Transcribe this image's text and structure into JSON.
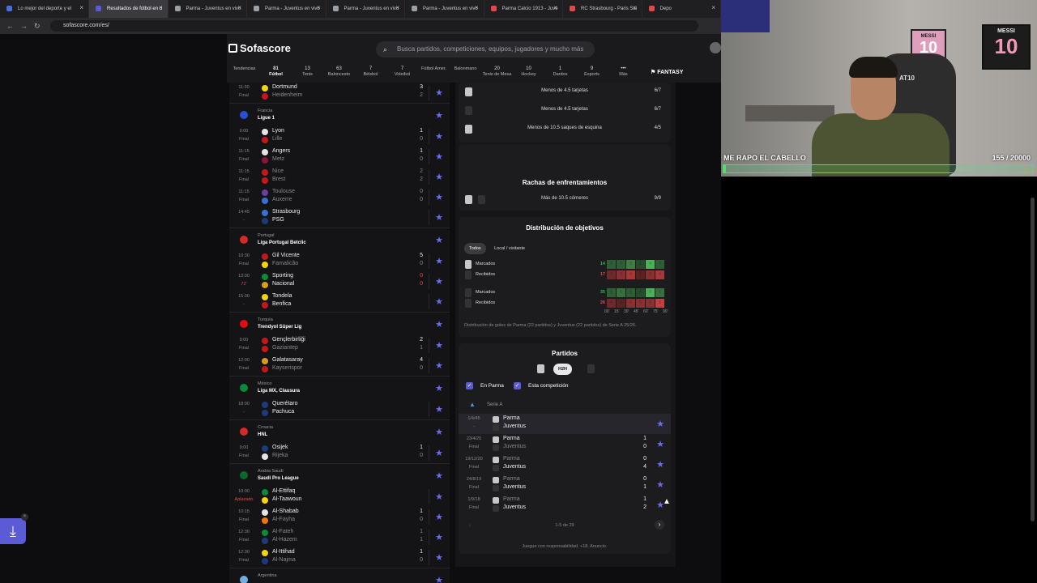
{
  "browser": {
    "tabs": [
      {
        "label": "Lo mejor del deporte y el",
        "color": "#4a6ee0"
      },
      {
        "label": "Resultados de fútbol en d",
        "color": "#5b5bd6"
      },
      {
        "label": "Parma - Juventus en vivo",
        "color": "#9aa0a6"
      },
      {
        "label": "Parma - Juventus en vivo",
        "color": "#9aa0a6"
      },
      {
        "label": "Parma - Juventus en vivo",
        "color": "#9aa0a6"
      },
      {
        "label": "Parma - Juventus en vivo",
        "color": "#9aa0a6"
      },
      {
        "label": "Parma Calcio 1913 - Juve",
        "color": "#e34848"
      },
      {
        "label": "RC Strasbourg - Paris Sai",
        "color": "#e34848"
      },
      {
        "label": "Depo",
        "color": "#e34848"
      }
    ],
    "active_tab": 1,
    "url": "sofascore.com/es/"
  },
  "header": {
    "logo": "Sofascore",
    "search_placeholder": "Busca partidos, competiciones, equipos, jugadores y mucho más",
    "fantasy": "FANTASY"
  },
  "sports": [
    {
      "label": "Tendencias",
      "count": ""
    },
    {
      "label": "Fútbol",
      "count": "81"
    },
    {
      "label": "Tenis",
      "count": "13"
    },
    {
      "label": "Baloncesto",
      "count": "63"
    },
    {
      "label": "Béisbol",
      "count": "7"
    },
    {
      "label": "Voleibol",
      "count": "7"
    },
    {
      "label": "Fútbol Amer.",
      "count": ""
    },
    {
      "label": "Balonmano",
      "count": ""
    },
    {
      "label": "Tenis de Mesa",
      "count": "20"
    },
    {
      "label": "Hockey",
      "count": "10"
    },
    {
      "label": "Dardos",
      "count": "1"
    },
    {
      "label": "Esports",
      "count": "9"
    },
    {
      "label": "Más",
      "count": "•••"
    }
  ],
  "left": [
    {
      "type": "match",
      "t1": "11:30",
      "t2": "Final",
      "home": "Dortmund",
      "away": "Heidenheim",
      "hs": "3",
      "as": "2",
      "hc": "#f5d400",
      "ac": "#c4161c",
      "hdim": false,
      "adim": true
    },
    {
      "type": "league",
      "country": "Francia",
      "name": "Ligue 1",
      "flag": "#2a4fd6"
    },
    {
      "type": "match",
      "t1": "9:00",
      "t2": "Final",
      "home": "Lyon",
      "away": "Lille",
      "hs": "1",
      "as": "0",
      "hc": "#e5e5e5",
      "ac": "#c4161c",
      "hdim": false,
      "adim": true
    },
    {
      "type": "match",
      "t1": "11:15",
      "t2": "Final",
      "home": "Angers",
      "away": "Metz",
      "hs": "1",
      "as": "0",
      "hc": "#e5e5e5",
      "ac": "#8a1538",
      "hdim": false,
      "adim": true
    },
    {
      "type": "match",
      "t1": "11:15",
      "t2": "Final",
      "home": "Nice",
      "away": "Brest",
      "hs": "2",
      "as": "2",
      "hc": "#c4161c",
      "ac": "#c4161c",
      "hdim": true,
      "adim": true
    },
    {
      "type": "match",
      "t1": "11:15",
      "t2": "Final",
      "home": "Toulouse",
      "away": "Auxerre",
      "hs": "0",
      "as": "0",
      "hc": "#6b3fa0",
      "ac": "#3a6fd0",
      "hdim": true,
      "adim": true
    },
    {
      "type": "match",
      "t1": "14:45",
      "t2": "-",
      "home": "Strasbourg",
      "away": "PSG",
      "hs": "",
      "as": "",
      "hc": "#3a6fd0",
      "ac": "#1d3a7a",
      "hdim": false,
      "adim": false
    },
    {
      "type": "league",
      "country": "Portugal",
      "name": "Liga Portugal Betclic",
      "flag": "#d42a2a"
    },
    {
      "type": "match",
      "t1": "10:30",
      "t2": "Final",
      "home": "Gil Vicente",
      "away": "Famalicão",
      "hs": "5",
      "as": "0",
      "hc": "#c4161c",
      "ac": "#f5d400",
      "hdim": false,
      "adim": true
    },
    {
      "type": "match",
      "t1": "13:00",
      "t2": "72'",
      "home": "Sporting",
      "away": "Nacional",
      "hs": "0",
      "as": "0",
      "hc": "#0a8a3a",
      "ac": "#d4a017",
      "hdim": false,
      "adim": false,
      "live": true
    },
    {
      "type": "match",
      "t1": "15:30",
      "t2": "-",
      "home": "Tondela",
      "away": "Benfica",
      "hs": "",
      "as": "",
      "hc": "#f5d400",
      "ac": "#c4161c",
      "hdim": false,
      "adim": false
    },
    {
      "type": "league",
      "country": "Turquía",
      "name": "Trendyol Süper Lig",
      "flag": "#e30a17"
    },
    {
      "type": "match",
      "t1": "9:00",
      "t2": "Final",
      "home": "Gençlerbirliği",
      "away": "Gaziantep",
      "hs": "2",
      "as": "1",
      "hc": "#c4161c",
      "ac": "#c4161c",
      "hdim": false,
      "adim": true
    },
    {
      "type": "match",
      "t1": "12:00",
      "t2": "Final",
      "home": "Galatasaray",
      "away": "Kayserispor",
      "hs": "4",
      "as": "0",
      "hc": "#d4a017",
      "ac": "#c4161c",
      "hdim": false,
      "adim": true
    },
    {
      "type": "league",
      "country": "México",
      "name": "Liga MX, Clausura",
      "flag": "#0a8a3a"
    },
    {
      "type": "match",
      "t1": "18:00",
      "t2": "-",
      "home": "Querétaro",
      "away": "Pachuca",
      "hs": "",
      "as": "",
      "hc": "#1d3a7a",
      "ac": "#1d3a7a",
      "hdim": false,
      "adim": false
    },
    {
      "type": "league",
      "country": "Croacia",
      "name": "HNL",
      "flag": "#d42a2a"
    },
    {
      "type": "match",
      "t1": "9:00",
      "t2": "Final",
      "home": "Osijek",
      "away": "Rijeka",
      "hs": "1",
      "as": "0",
      "hc": "#1d3a7a",
      "ac": "#e5e5e5",
      "hdim": false,
      "adim": true
    },
    {
      "type": "league",
      "country": "Arabia Saudí",
      "name": "Saudi Pro League",
      "flag": "#0a6a2a"
    },
    {
      "type": "match",
      "t1": "10:00",
      "t2": "Aplazado",
      "home": "Al-Ettifaq",
      "away": "Al-Taawoun",
      "hs": "",
      "as": "",
      "hc": "#0a8a3a",
      "ac": "#f5d400",
      "hdim": false,
      "adim": false,
      "live": true
    },
    {
      "type": "match",
      "t1": "10:15",
      "t2": "Final",
      "home": "Al-Shabab",
      "away": "Al-Fayha",
      "hs": "1",
      "as": "0",
      "hc": "#e5e5e5",
      "ac": "#f07800",
      "hdim": false,
      "adim": true
    },
    {
      "type": "match",
      "t1": "12:30",
      "t2": "Final",
      "home": "Al-Fateh",
      "away": "Al-Hazem",
      "hs": "1",
      "as": "1",
      "hc": "#0a8a3a",
      "ac": "#1d3a7a",
      "hdim": true,
      "adim": true
    },
    {
      "type": "match",
      "t1": "12:30",
      "t2": "Final",
      "home": "Al-Ittihad",
      "away": "Al-Najma",
      "hs": "1",
      "as": "0",
      "hc": "#f5d400",
      "ac": "#1d3a7a",
      "hdim": false,
      "adim": true
    },
    {
      "type": "league",
      "country": "Argentina",
      "name": "",
      "flag": "#74acdf"
    }
  ],
  "streaks": {
    "rows": [
      {
        "label": "Menos de 4.5 tarjetas",
        "value": "6/7",
        "icon": "#c7c7c7"
      },
      {
        "label": "Menos de 4.5 tarjetas",
        "value": "6/7",
        "icon": "#333"
      },
      {
        "label": "Menos de 10.5 saques de esquina",
        "value": "4/5",
        "icon": "#c7c7c7"
      }
    ],
    "h2h_title": "Rachas de enfrentamientos",
    "h2h_row": {
      "label": "Más de 10.5 córneres",
      "value": "9/9"
    }
  },
  "goals": {
    "title": "Distribución de objetivos",
    "filters": [
      "Todos",
      "Local / visitante"
    ],
    "rows": [
      {
        "label": "Marcados",
        "total": "14",
        "color": "#2fb44e",
        "cells": [
          "2",
          "2",
          "3",
          "1",
          "4",
          "2"
        ],
        "shade": [
          "#2e5e35",
          "#2e5e35",
          "#3f7d45",
          "#254d2c",
          "#48b25a",
          "#2e5e35"
        ],
        "icon": "#c7c7c7"
      },
      {
        "label": "Recibidos",
        "total": "17",
        "color": "#e34848",
        "cells": [
          "2",
          "3",
          "4",
          "1",
          "3",
          "4"
        ],
        "shade": [
          "#6e2a2a",
          "#8a3030",
          "#a53838",
          "#5a2323",
          "#8a3030",
          "#a53838"
        ],
        "icon": "#333"
      },
      {
        "label": "Marcados",
        "total": "35",
        "color": "#2fb44e",
        "cells": [
          "5",
          "6",
          "5",
          "4",
          "9",
          "6"
        ],
        "shade": [
          "#2e5e35",
          "#35703d",
          "#2e5e35",
          "#254d2c",
          "#48b25a",
          "#35703d"
        ],
        "icon": "#333"
      },
      {
        "label": "Recibidos",
        "total": "26",
        "color": "#e34848",
        "cells": [
          "4",
          "3",
          "5",
          "5",
          "5",
          "8"
        ],
        "shade": [
          "#6e2a2a",
          "#5a2323",
          "#8a3030",
          "#8a3030",
          "#8a3030",
          "#c44040"
        ],
        "icon": "#333"
      }
    ],
    "axis": [
      "00'",
      "15'",
      "30'",
      "45'",
      "60'",
      "75'",
      "90'"
    ],
    "note": "Distribución de goles de Parma (22 partidos) y Juventus (22 partidos) de Serie A 25/26."
  },
  "partidos": {
    "title": "Partidos",
    "tab": "H2H",
    "check1": "En Parma",
    "check2": "Esta competición",
    "competition": "Serie A",
    "matches": [
      {
        "t1": "1/4/45",
        "t2": "-",
        "home": "Parma",
        "away": "Juventus",
        "hs": "",
        "as": ""
      },
      {
        "t1": "23/4/25",
        "t2": "Final",
        "home": "Parma",
        "away": "Juventus",
        "hs": "1",
        "as": "0"
      },
      {
        "t1": "19/12/20",
        "t2": "Final",
        "home": "Parma",
        "away": "Juventus",
        "hs": "0",
        "as": "4"
      },
      {
        "t1": "24/8/19",
        "t2": "Final",
        "home": "Parma",
        "away": "Juventus",
        "hs": "0",
        "as": "1"
      },
      {
        "t1": "1/9/18",
        "t2": "Final",
        "home": "Parma",
        "away": "Juventus",
        "hs": "1",
        "as": "2"
      }
    ],
    "pager": "1-5 de 29",
    "disclaimer": "Juegue con responsabilidad. +18. Anuncio."
  },
  "stream": {
    "caption": "ME RAPO EL CABELLO",
    "progress": "155  / 20000",
    "progress_fraction": 0.0078,
    "frame1": "MESSI",
    "frame1b": "10",
    "frame2": "MESSI",
    "frame2b": "10",
    "chair": "AT10"
  },
  "colors": {
    "accent": "#5b5bd6",
    "win": "#2fb44e",
    "loss": "#e34848"
  }
}
